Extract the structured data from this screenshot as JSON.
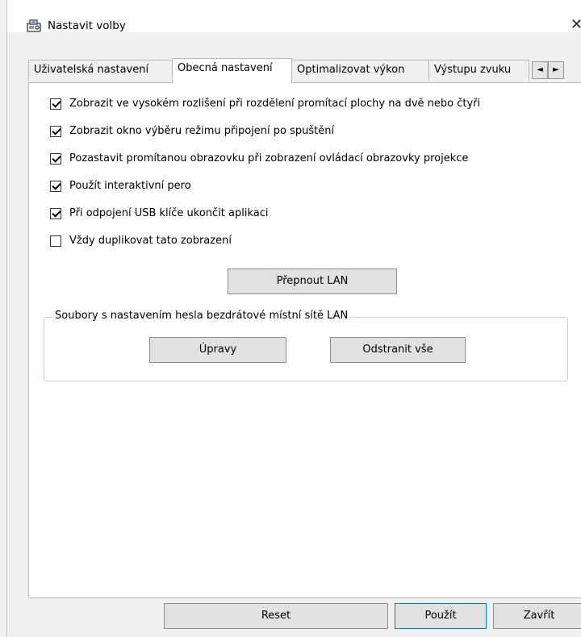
{
  "window": {
    "title": "Nastavit volby",
    "close_glyph": "✕"
  },
  "tabs": [
    {
      "label": "Uživatelská nastavení",
      "active": false
    },
    {
      "label": "Obecná nastavení",
      "active": true
    },
    {
      "label": "Optimalizovat výkon",
      "active": false
    },
    {
      "label": "Výstupu zvuku",
      "active": false
    }
  ],
  "tab_scroll": {
    "left": "◄",
    "right": "►"
  },
  "options": [
    {
      "label": "Zobrazit ve vysokém rozlišení při rozdělení promítací plochy na dvě nebo čtyři",
      "checked": true
    },
    {
      "label": "Zobrazit okno výběru režimu připojení po spuštění",
      "checked": true
    },
    {
      "label": "Pozastavit promítanou obrazovku při zobrazení ovládací obrazovky projekce",
      "checked": true
    },
    {
      "label": "Použít interaktivní pero",
      "checked": true
    },
    {
      "label": "Při odpojení USB klíče ukončit aplikaci",
      "checked": true
    },
    {
      "label": "Vždy duplikovat tato zobrazení",
      "checked": false
    }
  ],
  "switch_lan_label": "Přepnout LAN",
  "wlan_group": {
    "title": "Soubory s nastavením hesla bezdrátové místní sítě LAN",
    "edit_label": "Úpravy",
    "delete_all_label": "Odstranit vše"
  },
  "footer": {
    "reset_label": "Reset",
    "apply_label": "Použít",
    "close_label": "Zavřít"
  },
  "icons": {
    "app": "projector-icon",
    "close": "close-icon",
    "check": "checkmark-icon"
  },
  "colors": {
    "accent_border": "#0078d4",
    "panel_bg": "#ffffff",
    "window_bg": "#f0f0f0"
  }
}
